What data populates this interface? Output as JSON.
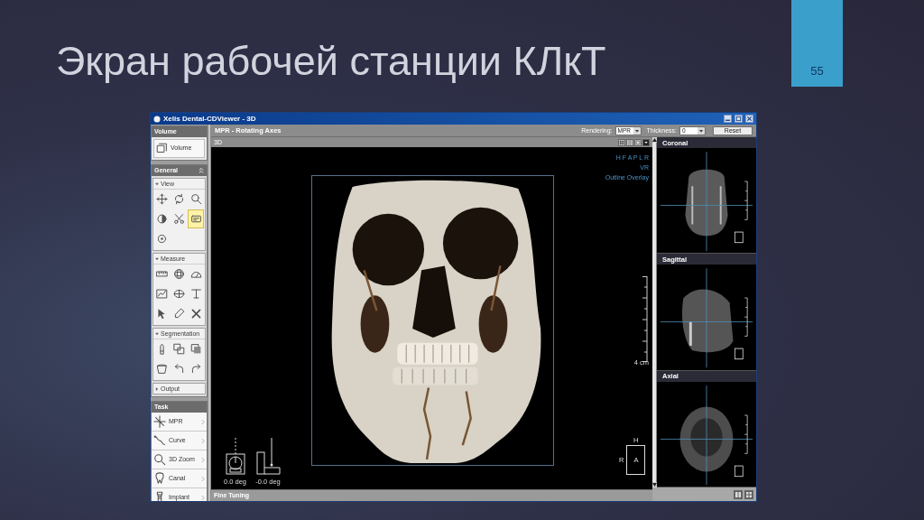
{
  "slide": {
    "title": "Экран рабочей станции КЛкТ",
    "page_number": "55"
  },
  "window": {
    "title": "Xelis Dental-CDViewer - 3D"
  },
  "sidebar": {
    "volume": {
      "title": "Volume",
      "button": "Volume"
    },
    "general": {
      "title": "General",
      "groups": [
        {
          "title": "View",
          "expanded": true,
          "tools": [
            {
              "selected": false
            },
            {
              "selected": false
            },
            {
              "selected": false
            },
            {
              "selected": false
            },
            {
              "selected": false
            },
            {
              "selected": true
            },
            {
              "selected": false
            }
          ]
        },
        {
          "title": "Measure",
          "expanded": true,
          "tools": [
            {
              "selected": false
            },
            {
              "selected": false
            },
            {
              "selected": false
            },
            {
              "selected": false
            },
            {
              "selected": false
            },
            {
              "selected": false
            },
            {
              "selected": false
            },
            {
              "selected": false
            },
            {
              "selected": false
            }
          ]
        },
        {
          "title": "Segmentation",
          "expanded": true,
          "tools": [
            {
              "selected": false
            },
            {
              "selected": false
            },
            {
              "selected": false
            },
            {
              "selected": false
            },
            {
              "selected": false
            },
            {
              "selected": false
            }
          ]
        },
        {
          "title": "Output",
          "expanded": false
        }
      ]
    },
    "task": {
      "title": "Task",
      "items": [
        {
          "label": "MPR"
        },
        {
          "label": "Curve"
        },
        {
          "label": "3D Zoom"
        },
        {
          "label": "Canal"
        },
        {
          "label": "Implant"
        }
      ]
    }
  },
  "toolbar": {
    "title": "MPR - Rotating Axes",
    "fields": [
      {
        "label": "Rendering:",
        "value": "MPR"
      },
      {
        "label": "Thickness:",
        "value": "0"
      }
    ],
    "reset_button": "Reset"
  },
  "main_view": {
    "title": "3D",
    "overlay": [
      "H F A P L R",
      "VR",
      "Outline Overlay"
    ],
    "scale_label": "4 cm",
    "angles": [
      "0.0 deg",
      "-0.0 deg"
    ],
    "orientation": {
      "top": "H",
      "left": "R",
      "center": "A"
    }
  },
  "side_views": [
    {
      "title": "Coronal"
    },
    {
      "title": "Sagittal"
    },
    {
      "title": "Axial"
    }
  ],
  "status_bar": {
    "title": "Fine Tuning"
  }
}
